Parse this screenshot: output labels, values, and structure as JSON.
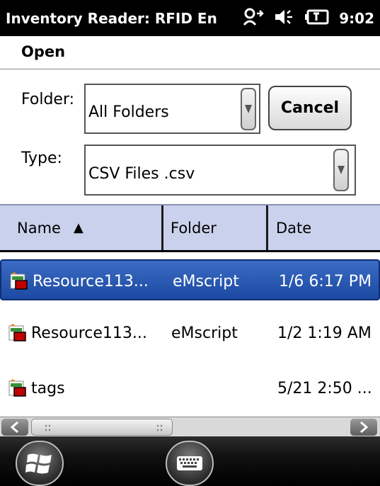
{
  "titlebar": {
    "title": "Inventory Reader: RFID En",
    "time": "9:02",
    "icons": [
      "connectivity-icon",
      "speaker-icon",
      "battery-icon"
    ]
  },
  "header": {
    "label": "Open"
  },
  "form": {
    "folder_label": "Folder:",
    "folder_value": "All Folders",
    "type_label": "Type:",
    "type_value": "CSV Files .csv",
    "cancel_label": "Cancel"
  },
  "table": {
    "columns": [
      "Name",
      "Folder",
      "Date"
    ],
    "sort_indicator": "▲",
    "rows": [
      {
        "name": "Resource113...",
        "folder": "eMscript",
        "date": "1/6 6:17 PM",
        "selected": true
      },
      {
        "name": "Resource113...",
        "folder": "eMscript",
        "date": "1/2 1:19 AM",
        "selected": false
      },
      {
        "name": "tags",
        "folder": "",
        "date": "5/21 2:50 ...",
        "selected": false
      }
    ]
  },
  "colors": {
    "header_bg": "#cad1ec",
    "selected_row": "#2a58b2",
    "titlebar_bg": "#000000"
  }
}
